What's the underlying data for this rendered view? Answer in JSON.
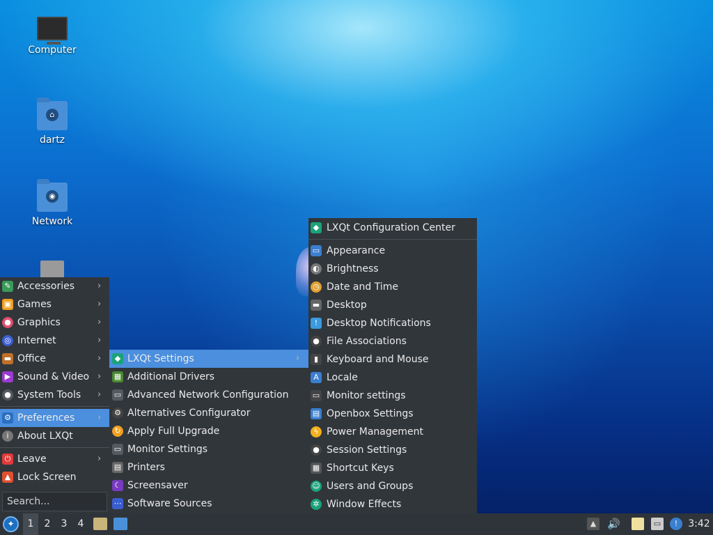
{
  "desktop": {
    "icons": [
      {
        "label": "Computer",
        "icon": "computer-icon"
      },
      {
        "label": "dartz",
        "icon": "home-folder-icon"
      },
      {
        "label": "Network",
        "icon": "network-folder-icon"
      },
      {
        "label": "",
        "icon": "trash-icon"
      }
    ]
  },
  "main_menu": {
    "items": [
      {
        "label": "Accessories",
        "icon": "accessories-icon",
        "icon_color": "#3a9a5a",
        "has_submenu": true
      },
      {
        "label": "Games",
        "icon": "games-icon",
        "icon_color": "#f0a020",
        "has_submenu": true
      },
      {
        "label": "Graphics",
        "icon": "graphics-icon",
        "icon_color": "#e04e6e",
        "has_submenu": true
      },
      {
        "label": "Internet",
        "icon": "internet-icon",
        "icon_color": "#3a5ed0",
        "has_submenu": true
      },
      {
        "label": "Office",
        "icon": "office-icon",
        "icon_color": "#c0702a",
        "has_submenu": true
      },
      {
        "label": "Sound & Video",
        "icon": "sound-video-icon",
        "icon_color": "#9b3ad0",
        "has_submenu": true
      },
      {
        "label": "System Tools",
        "icon": "system-tools-icon",
        "icon_color": "#555a60",
        "has_submenu": true
      },
      {
        "label": "Preferences",
        "icon": "preferences-icon",
        "icon_color": "#2a6fc0",
        "has_submenu": true,
        "selected": true
      },
      {
        "label": "About LXQt",
        "icon": "info-icon",
        "icon_color": "#777",
        "has_submenu": false
      },
      {
        "label": "Leave",
        "icon": "power-icon",
        "icon_color": "#e03a3a",
        "has_submenu": true
      },
      {
        "label": "Lock Screen",
        "icon": "lock-icon",
        "icon_color": "#e05030",
        "has_submenu": false
      }
    ],
    "search_placeholder": "Search..."
  },
  "preferences_menu": {
    "items": [
      {
        "label": "LXQt Settings",
        "icon": "lxqt-icon",
        "icon_color": "#1aa37a",
        "has_submenu": true,
        "selected": true
      },
      {
        "label": "Additional Drivers",
        "icon": "drivers-icon",
        "icon_color": "#4a8a30"
      },
      {
        "label": "Advanced Network Configuration",
        "icon": "network-config-icon",
        "icon_color": "#555a60"
      },
      {
        "label": "Alternatives Configurator",
        "icon": "alternatives-icon",
        "icon_color": "#444"
      },
      {
        "label": "Apply Full Upgrade",
        "icon": "upgrade-icon",
        "icon_color": "#f0a020"
      },
      {
        "label": "Monitor Settings",
        "icon": "monitor-icon",
        "icon_color": "#555a60"
      },
      {
        "label": "Printers",
        "icon": "printer-icon",
        "icon_color": "#666"
      },
      {
        "label": "Screensaver",
        "icon": "screensaver-icon",
        "icon_color": "#7a3ac0"
      },
      {
        "label": "Software Sources",
        "icon": "software-sources-icon",
        "icon_color": "#3a5ed0"
      }
    ]
  },
  "lxqt_settings_menu": {
    "header": {
      "label": "LXQt Configuration Center",
      "icon": "lxqt-icon",
      "icon_color": "#1aa37a"
    },
    "items": [
      {
        "label": "Appearance",
        "icon": "appearance-icon",
        "icon_color": "#3a7fd0"
      },
      {
        "label": "Brightness",
        "icon": "brightness-icon",
        "icon_color": "#777"
      },
      {
        "label": "Date and Time",
        "icon": "clock-icon",
        "icon_color": "#e0a030"
      },
      {
        "label": "Desktop",
        "icon": "desktop-icon",
        "icon_color": "#666"
      },
      {
        "label": "Desktop Notifications",
        "icon": "notification-icon",
        "icon_color": "#3a9ae0"
      },
      {
        "label": "File Associations",
        "icon": "file-assoc-icon",
        "icon_color": "#444"
      },
      {
        "label": "Keyboard and Mouse",
        "icon": "mouse-icon",
        "icon_color": "#444"
      },
      {
        "label": "Locale",
        "icon": "locale-icon",
        "icon_color": "#3a7fd0"
      },
      {
        "label": "Monitor settings",
        "icon": "monitor-icon",
        "icon_color": "#444"
      },
      {
        "label": "Openbox Settings",
        "icon": "openbox-icon",
        "icon_color": "#3a7fd0"
      },
      {
        "label": "Power Management",
        "icon": "power-management-icon",
        "icon_color": "#f0b020"
      },
      {
        "label": "Session Settings",
        "icon": "session-icon",
        "icon_color": "#444"
      },
      {
        "label": "Shortcut Keys",
        "icon": "keyboard-icon",
        "icon_color": "#555"
      },
      {
        "label": "Users and Groups",
        "icon": "users-icon",
        "icon_color": "#1aa37a"
      },
      {
        "label": "Window Effects",
        "icon": "window-effects-icon",
        "icon_color": "#1aa37a"
      }
    ]
  },
  "taskbar": {
    "desktops": [
      "1",
      "2",
      "3",
      "4"
    ],
    "active_desktop": "1",
    "quicklaunch": [
      {
        "icon": "file-manager-icon",
        "color": "#c9b47a"
      },
      {
        "icon": "show-desktop-icon",
        "color": "#4a90d9"
      }
    ],
    "tray": [
      {
        "icon": "eject-icon"
      },
      {
        "icon": "volume-icon"
      },
      {
        "icon": "clipboard-icon"
      },
      {
        "icon": "network-wired-icon"
      },
      {
        "icon": "update-notifier-icon"
      }
    ],
    "clock": "3:42"
  }
}
